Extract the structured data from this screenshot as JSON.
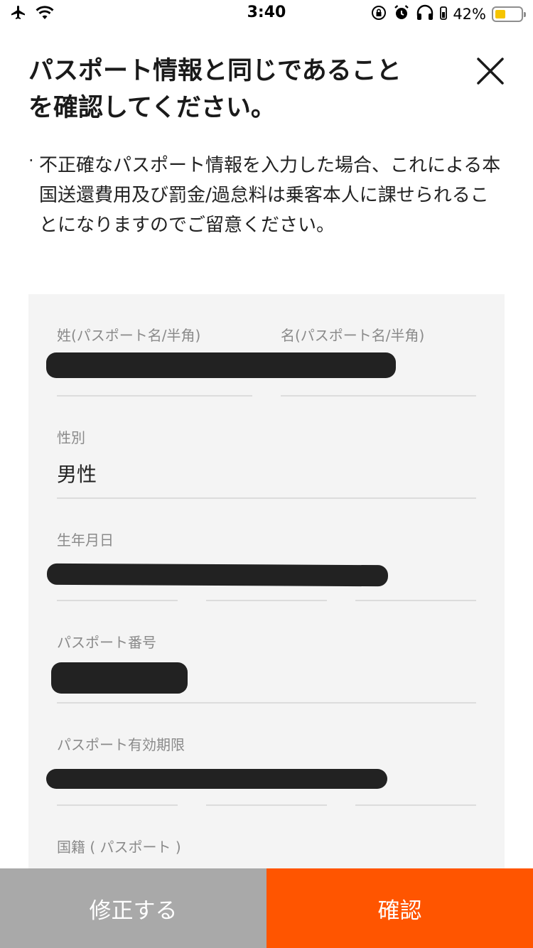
{
  "status_bar": {
    "time": "3:40",
    "battery_percent": "42%",
    "battery_level": 0.42,
    "icons": [
      "airplane-icon",
      "wifi-icon",
      "orientation-lock-icon",
      "alarm-icon",
      "headphones-icon",
      "battery-icon"
    ]
  },
  "header": {
    "title_line1": "パスポート情報と同じであること",
    "title_line2": "を確認してください。",
    "close_icon": "close-icon"
  },
  "notice": {
    "bullet": "·",
    "text": "不正確なパスポート情報を入力した場合、これによる本国送還費用及び罰金/過怠料は乗客本人に課せられることになりますのでご留意ください。"
  },
  "form": {
    "last_name_label": "姓(パスポート名/半角)",
    "first_name_label": "名(パスポート名/半角)",
    "gender_label": "性別",
    "gender_value": "男性",
    "birthdate_label": "生年月日",
    "passport_number_label": "パスポート番号",
    "passport_expiry_label": "パスポート有効期限",
    "nationality_label": "国籍 ( パスポート )"
  },
  "buttons": {
    "edit": "修正する",
    "confirm": "確認"
  },
  "colors": {
    "accent": "#ff5500",
    "secondary_button": "#a9a9a9",
    "panel_bg": "#f4f4f4",
    "battery": "#f5c400"
  }
}
